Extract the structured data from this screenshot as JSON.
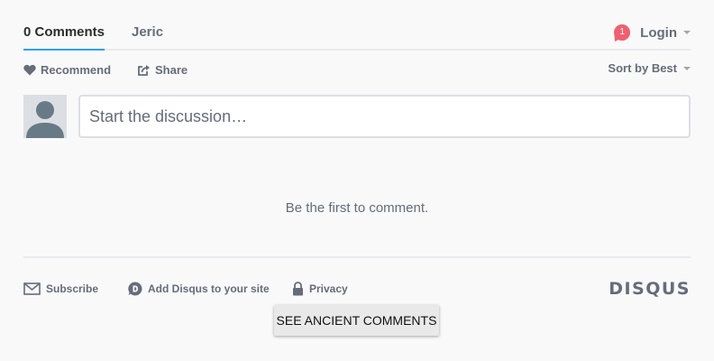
{
  "nav": {
    "comments_tab": "0 Comments",
    "site_tab": "Jeric",
    "notification_count": "1",
    "login_label": "Login"
  },
  "actions": {
    "recommend_label": "Recommend",
    "share_label": "Share",
    "sort_label": "Sort by Best"
  },
  "composer": {
    "placeholder": "Start the discussion…"
  },
  "empty_message": "Be the first to comment.",
  "footer": {
    "subscribe_label": "Subscribe",
    "add_disqus_label": "Add Disqus to your site",
    "privacy_label": "Privacy",
    "logo_text": "DISQUS"
  },
  "ancient_button_label": "SEE ANCIENT COMMENTS",
  "colors": {
    "accent": "#2e9fff",
    "badge": "#f05f70",
    "muted_text": "#656c7a",
    "background": "#f9f9f9"
  },
  "icons": [
    "heart-icon",
    "share-icon",
    "caret-down-icon",
    "avatar-placeholder-icon",
    "envelope-icon",
    "disqus-d-icon",
    "lock-icon"
  ]
}
